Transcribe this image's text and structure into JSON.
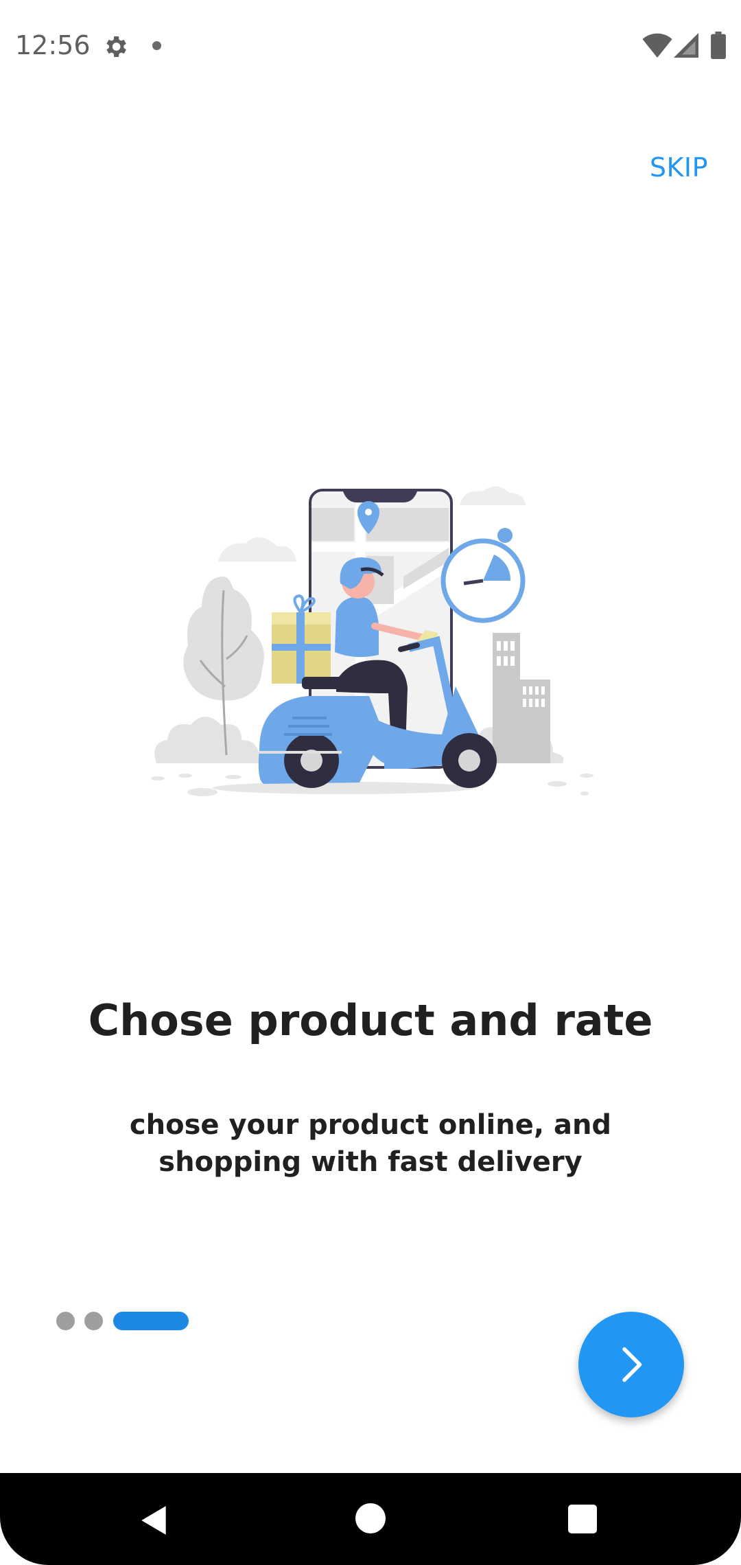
{
  "status_bar": {
    "time": "12:56",
    "icons": [
      "gear-icon",
      "notification-dot",
      "wifi-icon",
      "signal-icon",
      "battery-icon"
    ]
  },
  "onboarding": {
    "skip_label": "SKIP",
    "illustration": "delivery-scooter-illustration",
    "title": "Chose product and rate",
    "subtitle": "chose your product online, and shopping with fast delivery",
    "page_indicator": {
      "total": 3,
      "current": 3
    },
    "next_icon": "chevron-right-icon"
  },
  "colors": {
    "accent": "#2196f3",
    "indicator_inactive": "#9e9e9e",
    "text": "#202020"
  },
  "nav_bar": {
    "icons": [
      "back-icon",
      "home-icon",
      "recents-icon"
    ]
  }
}
